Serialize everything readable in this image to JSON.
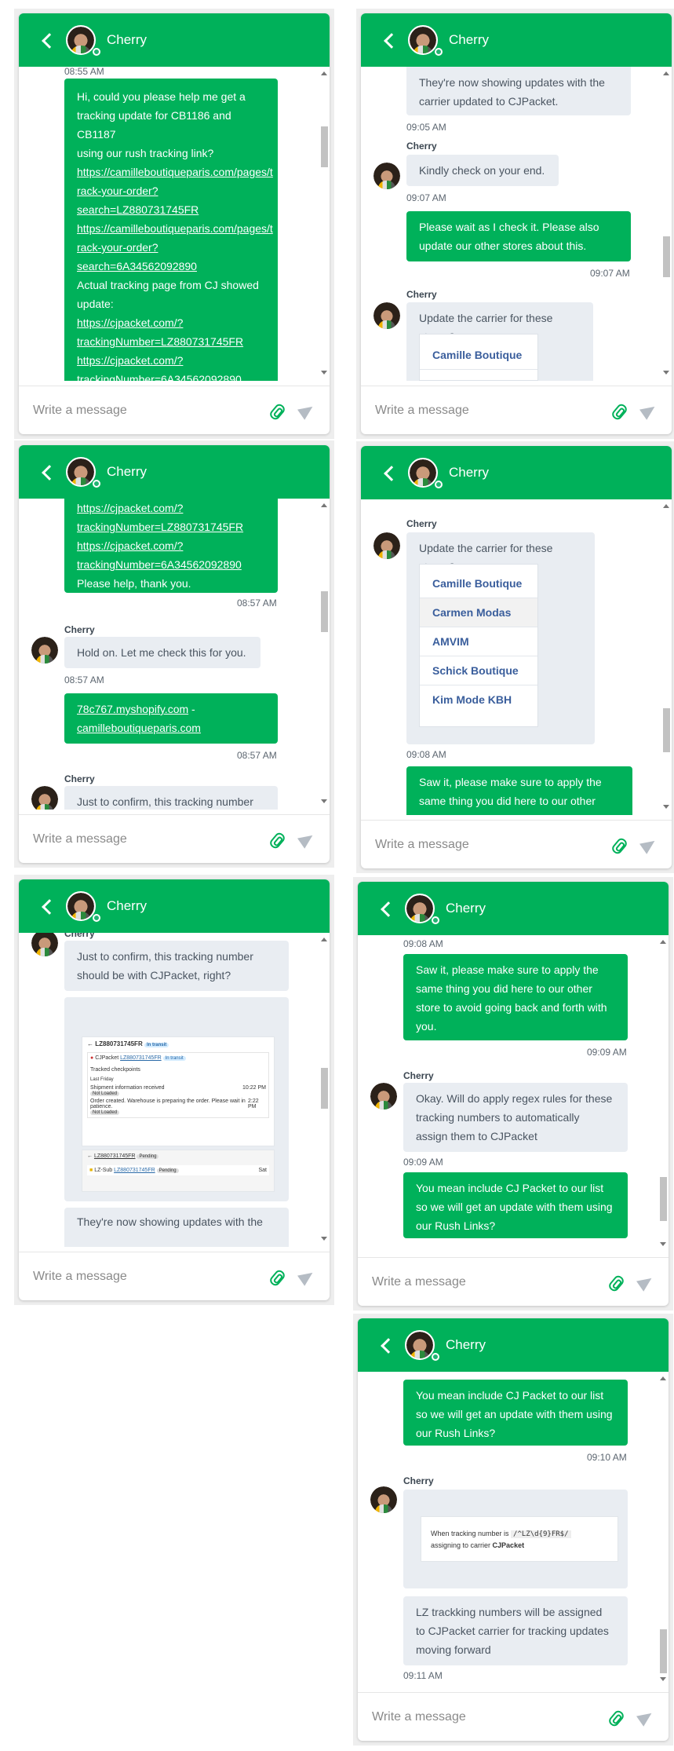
{
  "chat": {
    "agent_name": "Cherry",
    "input_placeholder": "Write a message"
  },
  "messages": {
    "intro_time": "08:55 AM",
    "request": {
      "line1": "Hi, could you please help me get a",
      "line2": "tracking update for CB1186 and CB1187",
      "line3": "using our rush tracking link?",
      "link1a": "https://camilleboutiqueparis.com/pages/t",
      "link1b": "rack-your-order?",
      "link1c": "search=LZ880731745FR",
      "link2a": "https://camilleboutiqueparis.com/pages/t",
      "link2b": "rack-your-order?",
      "link2c": "search=6A34562092890",
      "line4": "Actual tracking page from CJ showed",
      "line5": "update:",
      "link3a": "https://cjpacket.com/?",
      "link3b": "trackingNumber=LZ880731745FR",
      "link4a": "https://cjpacket.com/?",
      "link4b": "trackingNumber=6A34562092890",
      "line6": "Please help, thank you.",
      "time": "08:57 AM"
    },
    "hold_on": {
      "text": "Hold on. Let me check this for you.",
      "time": "08:57 AM"
    },
    "shop": {
      "line1": "78c767.myshopify.com",
      "line2": " -",
      "line3": "camilleboutiqueparis.com",
      "time": "08:57 AM"
    },
    "confirm": {
      "line1": "Just to confirm, this tracking number",
      "line2": "should be with CJPacket, right?"
    },
    "screenshot1": {
      "tracking": "LZ880731745FR",
      "badge": "In transit",
      "carrier": "CJPacket",
      "carrier_no": "LZ880731745FR",
      "tracked": "Tracked checkpoints",
      "last_friday": "Last Friday",
      "event1": "Shipment information received",
      "event1_time": "10:22 PM",
      "event1_tag": "Not Loaded",
      "event2": "Order created. Warehouse is preparing the order. Please wait in patience.",
      "event2_time": "2:22 PM",
      "event2_tag": "Not Loaded",
      "tracking2": "LZ880731745FR",
      "badge2": "Pending",
      "carrier2": "LZ-Sub",
      "carrier2_no": "LZ880731745FR",
      "badge3": "Pending",
      "time3": "Sat"
    },
    "updated": {
      "line1": "They're now showing updates with the",
      "line2": "carrier updated to CJPacket.",
      "time": "09:05 AM"
    },
    "kindly": {
      "text": "Kindly check on your end.",
      "time": "09:07 AM"
    },
    "please_wait": {
      "line1": "Please wait as I check it. Please also",
      "line2": "update our other stores about this.",
      "time": "09:07 AM"
    },
    "update_carrier": {
      "text": "Update the carrier for these stores?",
      "stores": [
        "Camille Boutique",
        "Carmen Modas",
        "AMVIM",
        "Schick Boutique",
        "Kim Mode KBH"
      ],
      "time": "09:08 AM"
    },
    "saw_it": {
      "line1": "Saw it, please make sure to apply the",
      "line2": "same thing you did here to our other",
      "line3": "store to avoid going back and forth with",
      "line4": "you.",
      "time": "09:09 AM"
    },
    "regex": {
      "line1": "Okay. Will do apply regex rules for these",
      "line2": "tracking numbers to automatically",
      "line3": "assign them to CJPacket",
      "time": "09:09 AM"
    },
    "include": {
      "line1": "You mean include CJ Packet to our list",
      "line2": "so we will get an update with them using",
      "line3": "our Rush Links?",
      "time": "09:10 AM"
    },
    "rule_shot": {
      "prefix": "When tracking number is ",
      "regex": "/^LZ\\d{9}FR$/",
      "line2": "assigning to carrier ",
      "carrier": "CJPacket"
    },
    "lz": {
      "line1": "LZ trackking numbers will be assigned",
      "line2": "to CJPacket carrier for tracking updates",
      "line3": "moving forward",
      "time": "09:11 AM"
    }
  },
  "colors": {
    "brand_green": "#00b15a",
    "incoming_bubble": "#e9edf2",
    "link_blue": "#3a5e9c"
  },
  "icons": [
    "back-chevron-icon",
    "attachment-icon",
    "send-icon",
    "online-dot-icon"
  ]
}
